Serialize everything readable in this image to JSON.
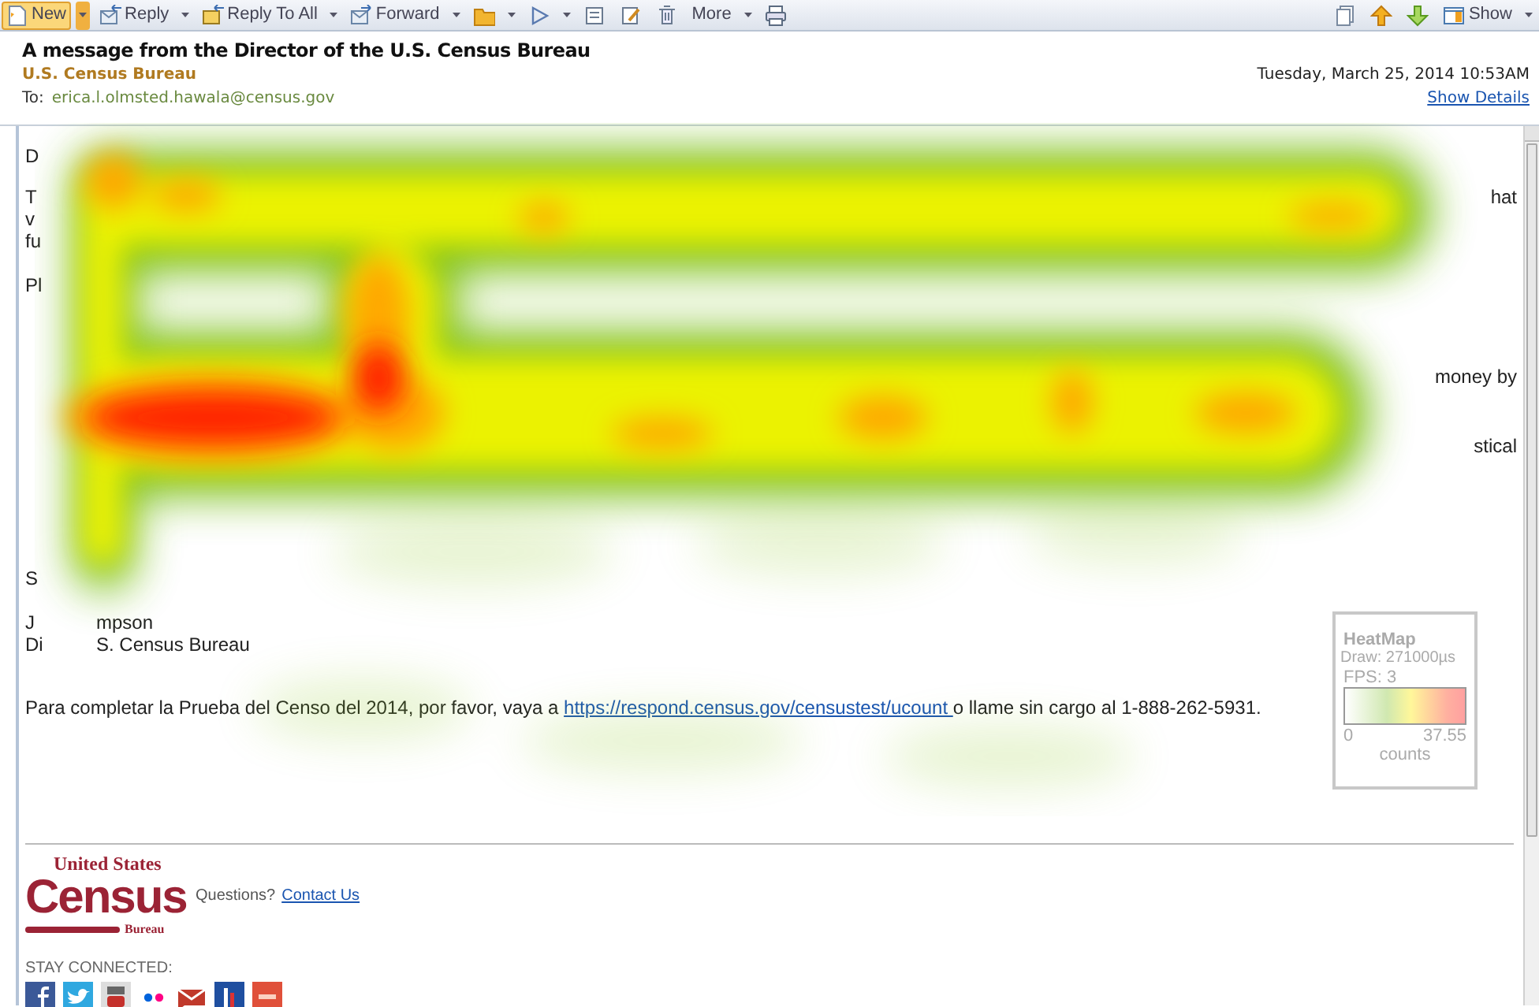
{
  "toolbar": {
    "left": [
      {
        "label": "New",
        "dropdown": true,
        "highlighted": true
      },
      {
        "label": "Reply",
        "dropdown": true,
        "highlighted": false
      },
      {
        "label": "Reply To All",
        "dropdown": true,
        "highlighted": false
      },
      {
        "label": "Forward",
        "dropdown": true,
        "highlighted": false
      },
      {
        "dropdown": true,
        "highlighted": false
      },
      {
        "dropdown": true,
        "highlighted": false
      },
      {
        "dropdown": false,
        "highlighted": false
      },
      {
        "dropdown": false,
        "highlighted": false
      },
      {
        "dropdown": false,
        "highlighted": false
      },
      {
        "label": "More",
        "dropdown": true,
        "highlighted": false
      },
      {
        "dropdown": false,
        "highlighted": false
      }
    ],
    "right": [
      {
        "dropdown": false,
        "highlighted": false
      },
      {
        "dropdown": false,
        "highlighted": false
      },
      {
        "dropdown": false,
        "highlighted": false
      },
      {
        "label": "Show",
        "dropdown": true,
        "highlighted": false
      }
    ]
  },
  "header": {
    "subject": "A message from the Director of the U.S. Census Bureau",
    "sender": "U.S. Census Bureau",
    "to_label": "To:",
    "to": "erica.l.olmsted.hawala@census.gov",
    "date": "Tuesday, March 25, 2014 10:53AM",
    "show_details": "Show Details"
  },
  "body": {
    "paragraphs": [
      {
        "lines": [
          {
            "left": "D"
          }
        ]
      },
      {
        "lines": [
          {
            "left": "T",
            "right": "hat"
          },
          {
            "left": "v"
          },
          {
            "left": "fu"
          }
        ]
      },
      {
        "lines": [
          {
            "left": "Pl"
          }
        ]
      },
      {
        "lines": [
          {
            "right": "money by"
          }
        ]
      },
      {
        "lines": [
          {
            "right": "stical"
          }
        ]
      },
      {
        "lines": [
          {
            "left": "S"
          }
        ]
      },
      {
        "lines": [
          {
            "left": "J",
            "middle": "mpson"
          },
          {
            "left": "Di",
            "middle": "S. Census Bureau"
          }
        ]
      },
      {
        "lines": [
          {
            "before": "Para completar la Prueba del Censo del 2014, por favor, vaya a ",
            "link": "https://respond.census.gov/censustest/ucount ",
            "after": "o llame sin cargo al 1-888-262-5931."
          }
        ]
      }
    ]
  },
  "footer": {
    "logo": {
      "top": "United States",
      "main": "Census",
      "bottom": "Bureau"
    },
    "questions": "Questions?",
    "contact_link": "Contact Us",
    "stay_connected": "STAY CONNECTED:"
  },
  "heatmap_legend": {
    "title": "HeatMap",
    "draw": "Draw: 271000µs",
    "fps": "FPS: 3",
    "min": "0",
    "max": "37.55",
    "unit": "counts"
  }
}
